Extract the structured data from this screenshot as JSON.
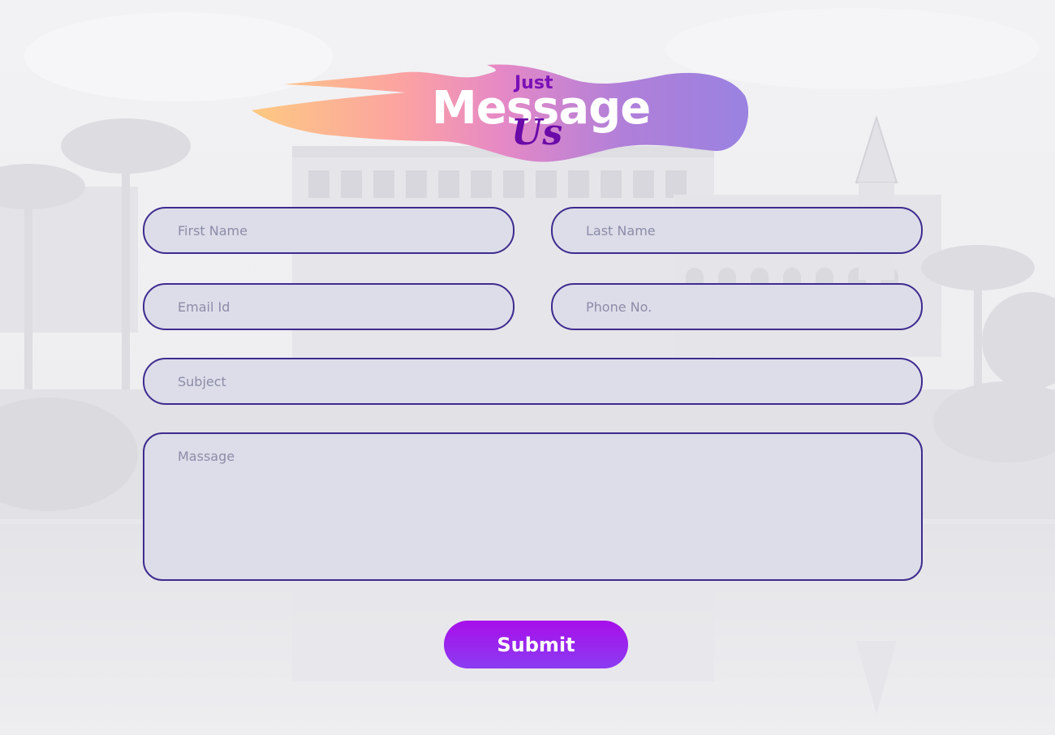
{
  "logo": {
    "word_just": "Just",
    "word_message": "Message",
    "word_us": "Us"
  },
  "form": {
    "first_name_placeholder": "First Name",
    "last_name_placeholder": "Last Name",
    "email_placeholder": "Email Id",
    "phone_placeholder": "Phone No.",
    "subject_placeholder": "Subject",
    "message_placeholder": "Massage",
    "submit_label": "Submit"
  },
  "colors": {
    "field_border": "#3f2b8f",
    "field_fill": "#dcdde9",
    "submit_top": "#a80fe9",
    "submit_bottom": "#8b3cf2",
    "logo_accent": "#7a10b8"
  },
  "icons": {
    "background": "hotel-pool-photo"
  }
}
